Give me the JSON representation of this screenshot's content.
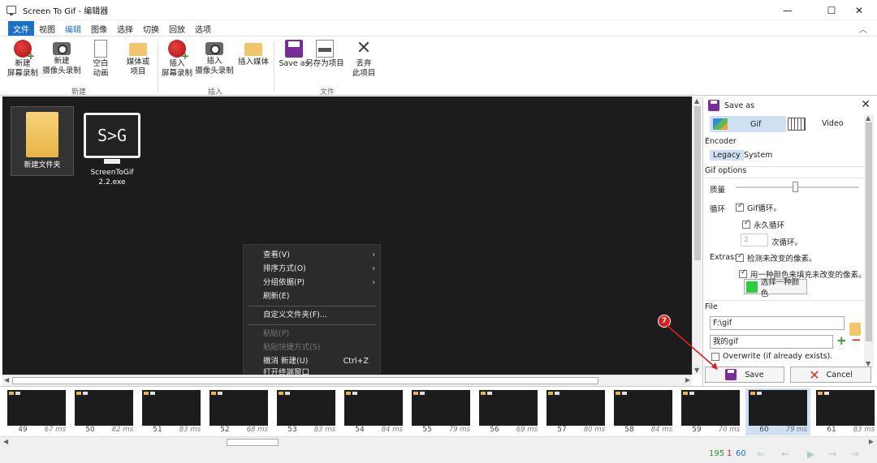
{
  "window": {
    "title": "Screen To Gif - 编辑器",
    "controls": {
      "minimize": "—",
      "maximize": "☐",
      "close": "✕"
    }
  },
  "tabs": [
    {
      "label": "文件",
      "state": "active"
    },
    {
      "label": "视图",
      "state": "normal"
    },
    {
      "label": "编辑",
      "state": "hover"
    },
    {
      "label": "图像",
      "state": "normal"
    },
    {
      "label": "选择",
      "state": "normal"
    },
    {
      "label": "切换",
      "state": "normal"
    },
    {
      "label": "回放",
      "state": "normal"
    },
    {
      "label": "选项",
      "state": "normal"
    }
  ],
  "ribbon": {
    "new_screen": "新建\n屏幕录制",
    "new_webcam": "新建\n摄像头录制",
    "blank_anim": "空白\n动画",
    "media_project": "媒体或\n项目",
    "group_new": "新建",
    "insert_screen": "插入\n屏幕录制",
    "insert_webcam": "插入\n摄像头录制",
    "insert_media": "插入媒体",
    "group_insert": "插入",
    "save_as": "Save as",
    "save_project": "另存为项目",
    "discard": "丢弃\n此项目",
    "group_file": "文件"
  },
  "desktop": {
    "folder_label": "新建文件夹",
    "stg_label": "ScreenToGif\n2.2.exe",
    "stg_logo": "S>G"
  },
  "context_menu": {
    "view": "查看(V)",
    "sort": "排序方式(O)",
    "group": "分组依据(P)",
    "refresh": "刷新(E)",
    "customize": "自定义文件夹(F)...",
    "paste": "粘贴(P)",
    "paste_shortcut": "粘贴快捷方式(S)",
    "undo": "撤消 新建(U)",
    "undo_accel": "Ctrl+Z",
    "cutoff": "打开终端窗口"
  },
  "panel": {
    "title": "Save as",
    "fmt_gif": "Gif",
    "fmt_video": "Video",
    "encoder_label": "Encoder",
    "encoder_legacy": "Legacy",
    "encoder_system": "System",
    "gif_options": "Gif options",
    "quality_label": "质量",
    "quality_value": 0.47,
    "loop_label": "循环",
    "gif_loop": "Gif循环。",
    "forever_loop": "永久循环",
    "loop_count": "2",
    "loop_count_suffix": "次循环。",
    "extras_label": "Extras:",
    "detect_unchanged": "检测未改变的像素。",
    "fill_unchanged": "用一种颜色来填充未改变的像素。",
    "choose_color": "选择一种颜色",
    "file_label": "File",
    "path": "F:\\gif",
    "filename": "我的gif",
    "overwrite": "Overwrite (if already exists).",
    "save_btn": "Save",
    "cancel_btn": "Cancel"
  },
  "annotation": {
    "badge": "7"
  },
  "frames": [
    {
      "num": "49",
      "ms": "67 ms"
    },
    {
      "num": "50",
      "ms": "82 ms"
    },
    {
      "num": "51",
      "ms": "83 ms"
    },
    {
      "num": "52",
      "ms": "68 ms"
    },
    {
      "num": "53",
      "ms": "83 ms"
    },
    {
      "num": "54",
      "ms": "84 ms"
    },
    {
      "num": "55",
      "ms": "79 ms"
    },
    {
      "num": "56",
      "ms": "69 ms"
    },
    {
      "num": "57",
      "ms": "80 ms"
    },
    {
      "num": "58",
      "ms": "84 ms"
    },
    {
      "num": "59",
      "ms": "70 ms"
    },
    {
      "num": "60",
      "ms": "79 ms"
    },
    {
      "num": "61",
      "ms": "83 ms"
    }
  ],
  "status": {
    "total": "195",
    "selected": "1",
    "current": "60"
  },
  "colors": {
    "accent": "#1e6fc8",
    "selection": "#cfe0f5",
    "total": "#2a8a2a",
    "sel_count": "#d82020"
  }
}
